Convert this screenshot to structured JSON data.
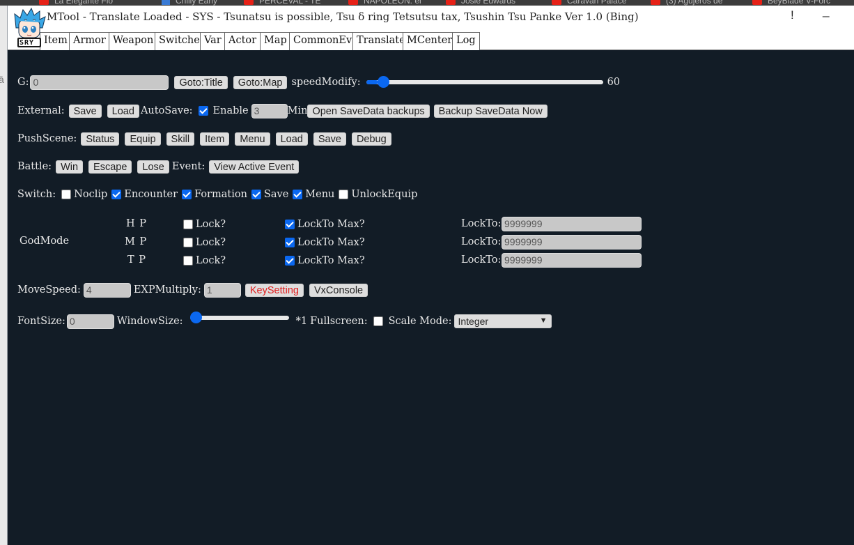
{
  "browser_tabs": [
    {
      "label": "La Elegante Flo",
      "kind": "yt"
    },
    {
      "label": "Chilly Early",
      "kind": "gr"
    },
    {
      "label": "PERCEVAL - TE",
      "kind": "yt"
    },
    {
      "label": "NAPOLEON: el",
      "kind": "yt"
    },
    {
      "label": "Josie Edwards",
      "kind": "yt"
    },
    {
      "label": "Caravan Palace",
      "kind": "yt"
    },
    {
      "label": "(3) Agujeros de",
      "kind": "yt"
    },
    {
      "label": "BeyBlade V-Forc",
      "kind": "yt"
    }
  ],
  "left_edge_glyph": "ā",
  "window": {
    "title": "MTool - Translate Loaded - SYS - Tsunatsu is possible, Tsu δ ring Tetsutsu tax, Tsushin Tsu Panke Ver 1.0 (Bing)",
    "alert_glyph": "!",
    "minimize_glyph": "_",
    "logo_text": "SRY"
  },
  "tabs": [
    "Item",
    "Armor",
    "Weapon",
    "Switche",
    "Var",
    "Actor",
    "Map",
    "CommonEv",
    "Translate",
    "MCenter",
    "Log"
  ],
  "gold": {
    "label": "G:",
    "value": "0",
    "goto_title": "Goto:Title",
    "goto_map": "Goto:Map",
    "speed_label": "speedModify:",
    "speed_value": "60",
    "speed_fraction": 0.05
  },
  "external": {
    "label": "External:",
    "save": "Save",
    "load": "Load",
    "autosave_label": "AutoSave:",
    "enable_label": "Enable",
    "enable_checked": true,
    "minutes": "3",
    "min_label": "Min",
    "open_backups": "Open SaveData backups",
    "backup_now": "Backup SaveData Now"
  },
  "push_scene": {
    "label": "PushScene:",
    "buttons": [
      "Status",
      "Equip",
      "Skill",
      "Item",
      "Menu",
      "Load",
      "Save",
      "Debug"
    ]
  },
  "battle": {
    "label": "Battle:",
    "win": "Win",
    "escape": "Escape",
    "lose": "Lose",
    "event_label": "Event:",
    "view_event": "View Active Event"
  },
  "switch": {
    "label": "Switch:",
    "items": [
      {
        "label": "Noclip",
        "checked": false
      },
      {
        "label": "Encounter",
        "checked": true
      },
      {
        "label": "Formation",
        "checked": true
      },
      {
        "label": "Save",
        "checked": true
      },
      {
        "label": "Menu",
        "checked": true
      },
      {
        "label": "UnlockEquip",
        "checked": false
      }
    ]
  },
  "godmode": {
    "label": "GodMode",
    "rows": [
      {
        "stat": "H P",
        "lock_label": "Lock?",
        "lock": false,
        "max_label": "LockTo Max?",
        "max": true,
        "lockto_label": "LockTo:",
        "value": "9999999"
      },
      {
        "stat": "M P",
        "lock_label": "Lock?",
        "lock": false,
        "max_label": "LockTo Max?",
        "max": true,
        "lockto_label": "LockTo:",
        "value": "9999999"
      },
      {
        "stat": "T P",
        "lock_label": "Lock?",
        "lock": false,
        "max_label": "LockTo Max?",
        "max": true,
        "lockto_label": "LockTo:",
        "value": "9999999"
      }
    ]
  },
  "move": {
    "label": "MoveSpeed:",
    "value": "4",
    "exp_label": "EXPMultiply:",
    "exp_value": "1",
    "key_setting": "KeySetting",
    "vx_console": "VxConsole"
  },
  "font": {
    "label": "FontSize:",
    "value": "0",
    "window_label": "WindowSize:",
    "window_fraction": 0.0,
    "scale_text": "*1",
    "fullscreen_label": "Fullscreen:",
    "fullscreen": false,
    "scale_mode_label": "Scale Mode:",
    "scale_mode": "Integer"
  },
  "colors": {
    "accent": "#0b68f0",
    "background": "#121c26",
    "warning_text": "#e02020"
  }
}
